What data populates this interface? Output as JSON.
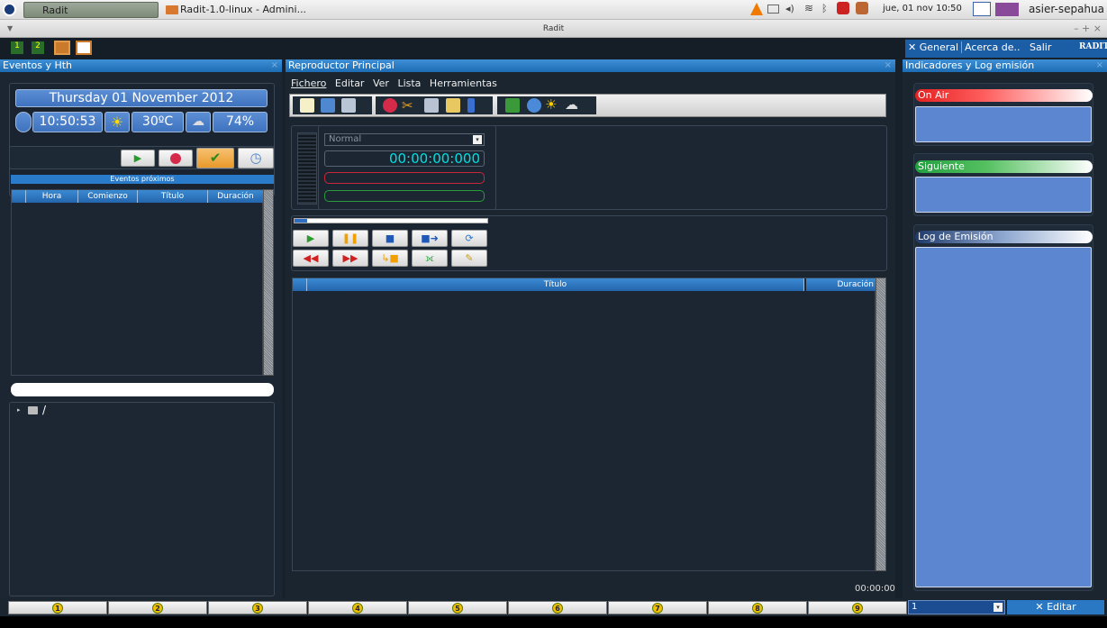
{
  "system_bar": {
    "task_radit": "Radit",
    "task_folder": "Radit-1.0-linux - Admini...",
    "clock": "jue, 01 nov 10:50",
    "user": "asier-sepahua"
  },
  "window": {
    "title": "Radit",
    "controls": "– + ×"
  },
  "left_panel": {
    "header": "Eventos y Hth",
    "date": "Thursday  01 November 2012",
    "time": "10:50:53",
    "temperature": "30ºC",
    "humidity": "74%",
    "events_header": "Eventos próximos",
    "columns": [
      "Hora",
      "Comienzo",
      "Título",
      "Duración"
    ],
    "tree_root": "/"
  },
  "center_panel": {
    "header": "Reproductor Principal",
    "menu": [
      "Fichero",
      "Editar",
      "Ver",
      "Lista",
      "Herramientas"
    ],
    "mode": "Normal",
    "counter": "00:00:00:000",
    "playlist_columns": [
      "Título",
      "Duración"
    ],
    "total_time": "00:00:00"
  },
  "right_tabs": {
    "general": "General",
    "about": "Acerca de..",
    "exit": "Salir",
    "logo": "RADIT"
  },
  "right_panel": {
    "header": "Indicadores y Log emisión",
    "on_air": "On Air",
    "next": "Siguiente",
    "log": "Log de Emisión"
  },
  "bottom_bar": {
    "hotkeys": [
      "1",
      "2",
      "3",
      "4",
      "5",
      "6",
      "7",
      "8",
      "9"
    ],
    "selector_value": "1",
    "edit_label": "Editar"
  },
  "colors": {
    "accent": "#2a78c4",
    "bg": "#16212c",
    "on_air": "#e53030",
    "next": "#3aa83a"
  }
}
